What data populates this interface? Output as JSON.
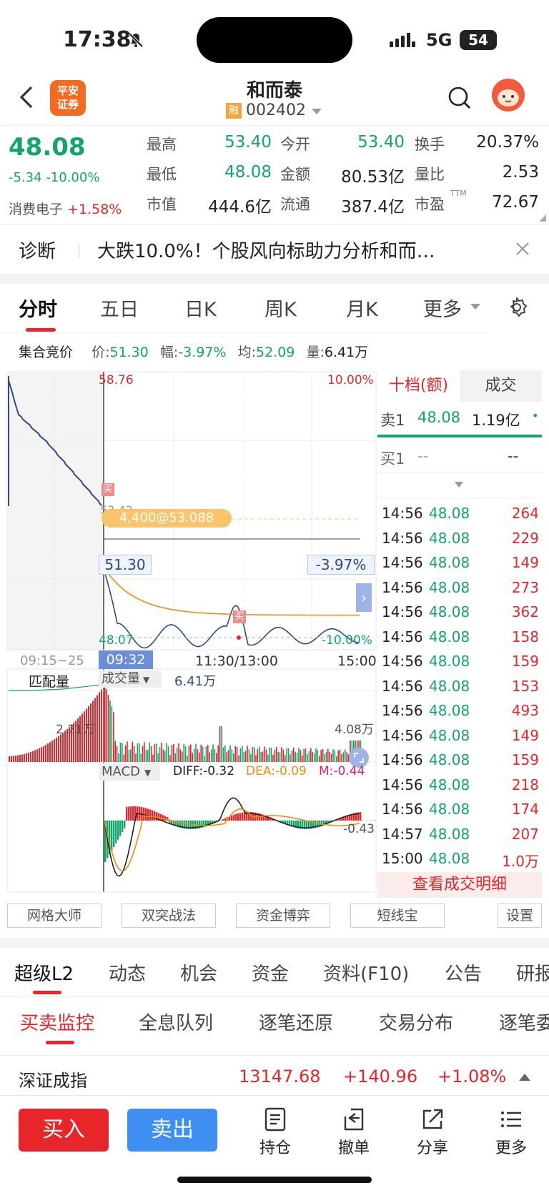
{
  "status": {
    "time": "17:38",
    "network": "5G",
    "battery": "54"
  },
  "header": {
    "title": "和而泰",
    "code": "002402",
    "rong": "融",
    "broker_line1": "平安",
    "broker_line2": "证券"
  },
  "quote": {
    "price": "48.08",
    "change": "-5.34",
    "change_pct": "-10.00%",
    "sector_name": "消费电子",
    "sector_pct": "+1.58%",
    "rows": [
      [
        {
          "k": "最高",
          "v": "53.40",
          "c": "green"
        },
        {
          "k": "今开",
          "v": "53.40",
          "c": "green"
        },
        {
          "k": "换手",
          "v": "20.37%",
          "c": "dark"
        }
      ],
      [
        {
          "k": "最低",
          "v": "48.08",
          "c": "green"
        },
        {
          "k": "金额",
          "v": "80.53亿",
          "c": "dark"
        },
        {
          "k": "量比",
          "v": "2.53",
          "c": "dark"
        }
      ],
      [
        {
          "k": "市值",
          "v": "444.6亿",
          "c": "dark"
        },
        {
          "k": "流通",
          "v": "387.4亿",
          "c": "dark"
        },
        {
          "k": "市盈",
          "v": "72.67",
          "c": "dark",
          "sup": "TTM"
        }
      ]
    ]
  },
  "diagnosis": {
    "label": "诊断",
    "text": "大跌10.0%！个股风向标助力分析和而…"
  },
  "tabs": [
    "分时",
    "五日",
    "日K",
    "周K",
    "月K",
    "更多"
  ],
  "auction": {
    "label": "集合竞价",
    "price_k": "价:",
    "price": "51.30",
    "amp_k": "幅:",
    "amp": "-3.97%",
    "avg_k": "均:",
    "avg": "52.09",
    "vol_k": "量:",
    "vol": "6.41万"
  },
  "chart": {
    "high_label": "58.76",
    "high_pct": "10.00%",
    "low_label": "48.07",
    "low_pct": "-10.00%",
    "trade_marker": "4,400@53.088",
    "partial_label": "53.42",
    "crosshair_price": "51.30",
    "crosshair_pct": "-3.97%",
    "time_labels": [
      "09:15~25",
      "09:32",
      "11:30/13:00",
      "15:00"
    ],
    "buy_mark": "买",
    "vol_left_label": "匹配量",
    "vol_tab": "成交量",
    "vol_value": "6.41万",
    "vol_left_max": "2.21万",
    "vol_right_max": "4.08万",
    "macd_tab": "MACD",
    "diff": "DIFF:-0.32",
    "dea": "DEA:-0.09",
    "m": "M:-0.44",
    "macd_min": "-0.43"
  },
  "order_book": {
    "tab_active": "十档(额)",
    "tab_other": "成交",
    "sell1": {
      "label": "卖1",
      "price": "48.08",
      "amount": "1.19亿"
    },
    "buy1": {
      "label": "买1",
      "price": "--",
      "amount": "--"
    },
    "trades": [
      {
        "t": "14:56",
        "p": "48.08",
        "v": "264"
      },
      {
        "t": "14:56",
        "p": "48.08",
        "v": "229"
      },
      {
        "t": "14:56",
        "p": "48.08",
        "v": "149"
      },
      {
        "t": "14:56",
        "p": "48.08",
        "v": "273"
      },
      {
        "t": "14:56",
        "p": "48.08",
        "v": "362"
      },
      {
        "t": "14:56",
        "p": "48.08",
        "v": "158"
      },
      {
        "t": "14:56",
        "p": "48.08",
        "v": "159"
      },
      {
        "t": "14:56",
        "p": "48.08",
        "v": "153"
      },
      {
        "t": "14:56",
        "p": "48.08",
        "v": "493"
      },
      {
        "t": "14:56",
        "p": "48.08",
        "v": "149"
      },
      {
        "t": "14:56",
        "p": "48.08",
        "v": "159"
      },
      {
        "t": "14:56",
        "p": "48.08",
        "v": "218"
      },
      {
        "t": "14:56",
        "p": "48.08",
        "v": "174"
      },
      {
        "t": "14:57",
        "p": "48.08",
        "v": "207"
      },
      {
        "t": "15:00",
        "p": "48.08",
        "v": "1.0万"
      }
    ],
    "detail_link": "查看成交明细"
  },
  "tools": [
    "网格大师",
    "双突战法",
    "资金博弈",
    "短线宝"
  ],
  "tools_settings": "设置",
  "section_tabs": [
    "超级L2",
    "动态",
    "机会",
    "资金",
    "资料(F10)",
    "公告",
    "研报"
  ],
  "sub_tabs": [
    "买卖监控",
    "全息队列",
    "逐笔还原",
    "交易分布",
    "逐笔委托"
  ],
  "index": {
    "name": "深证成指",
    "value": "13147.68",
    "change": "+140.96",
    "pct": "+1.08%"
  },
  "bottom": {
    "buy": "买入",
    "sell": "卖出",
    "icons": [
      {
        "label": "持仓",
        "icon": "position-icon"
      },
      {
        "label": "撤单",
        "icon": "cancel-order-icon"
      },
      {
        "label": "分享",
        "icon": "share-icon"
      },
      {
        "label": "更多",
        "icon": "more-icon"
      }
    ]
  }
}
